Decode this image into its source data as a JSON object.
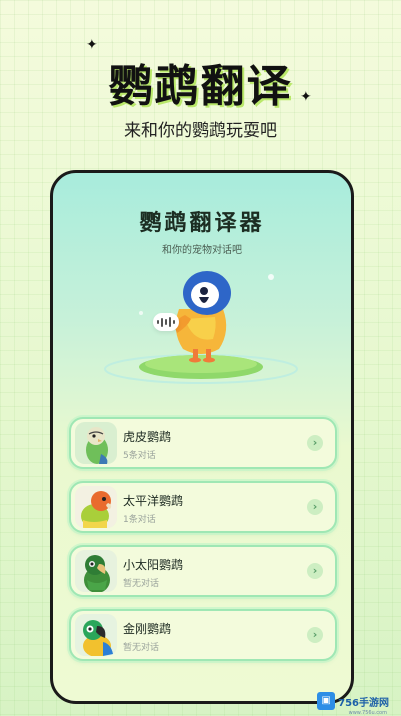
{
  "hero": {
    "title": "鹦鹉翻译",
    "subtitle": "来和你的鹦鹉玩耍吧"
  },
  "app": {
    "title": "鹦鹉翻译器",
    "subtitle": "和你的宠物对话吧"
  },
  "parrots": [
    {
      "name": "虎皮鹦鹉",
      "count": "5条对话",
      "avatar_icon": "budgie-icon"
    },
    {
      "name": "太平洋鹦鹉",
      "count": "1条对话",
      "avatar_icon": "pacific-parrotlet-icon"
    },
    {
      "name": "小太阳鹦鹉",
      "count": "暂无对话",
      "avatar_icon": "sun-conure-icon"
    },
    {
      "name": "金刚鹦鹉",
      "count": "暂无对话",
      "avatar_icon": "macaw-icon"
    }
  ],
  "watermark": {
    "text": "756手游网",
    "url": "www.756u.com"
  },
  "colors": {
    "accent_green": "#9fe7b4",
    "card_bg": "#f3fbdc",
    "title_shadow": "#b9e86a"
  }
}
